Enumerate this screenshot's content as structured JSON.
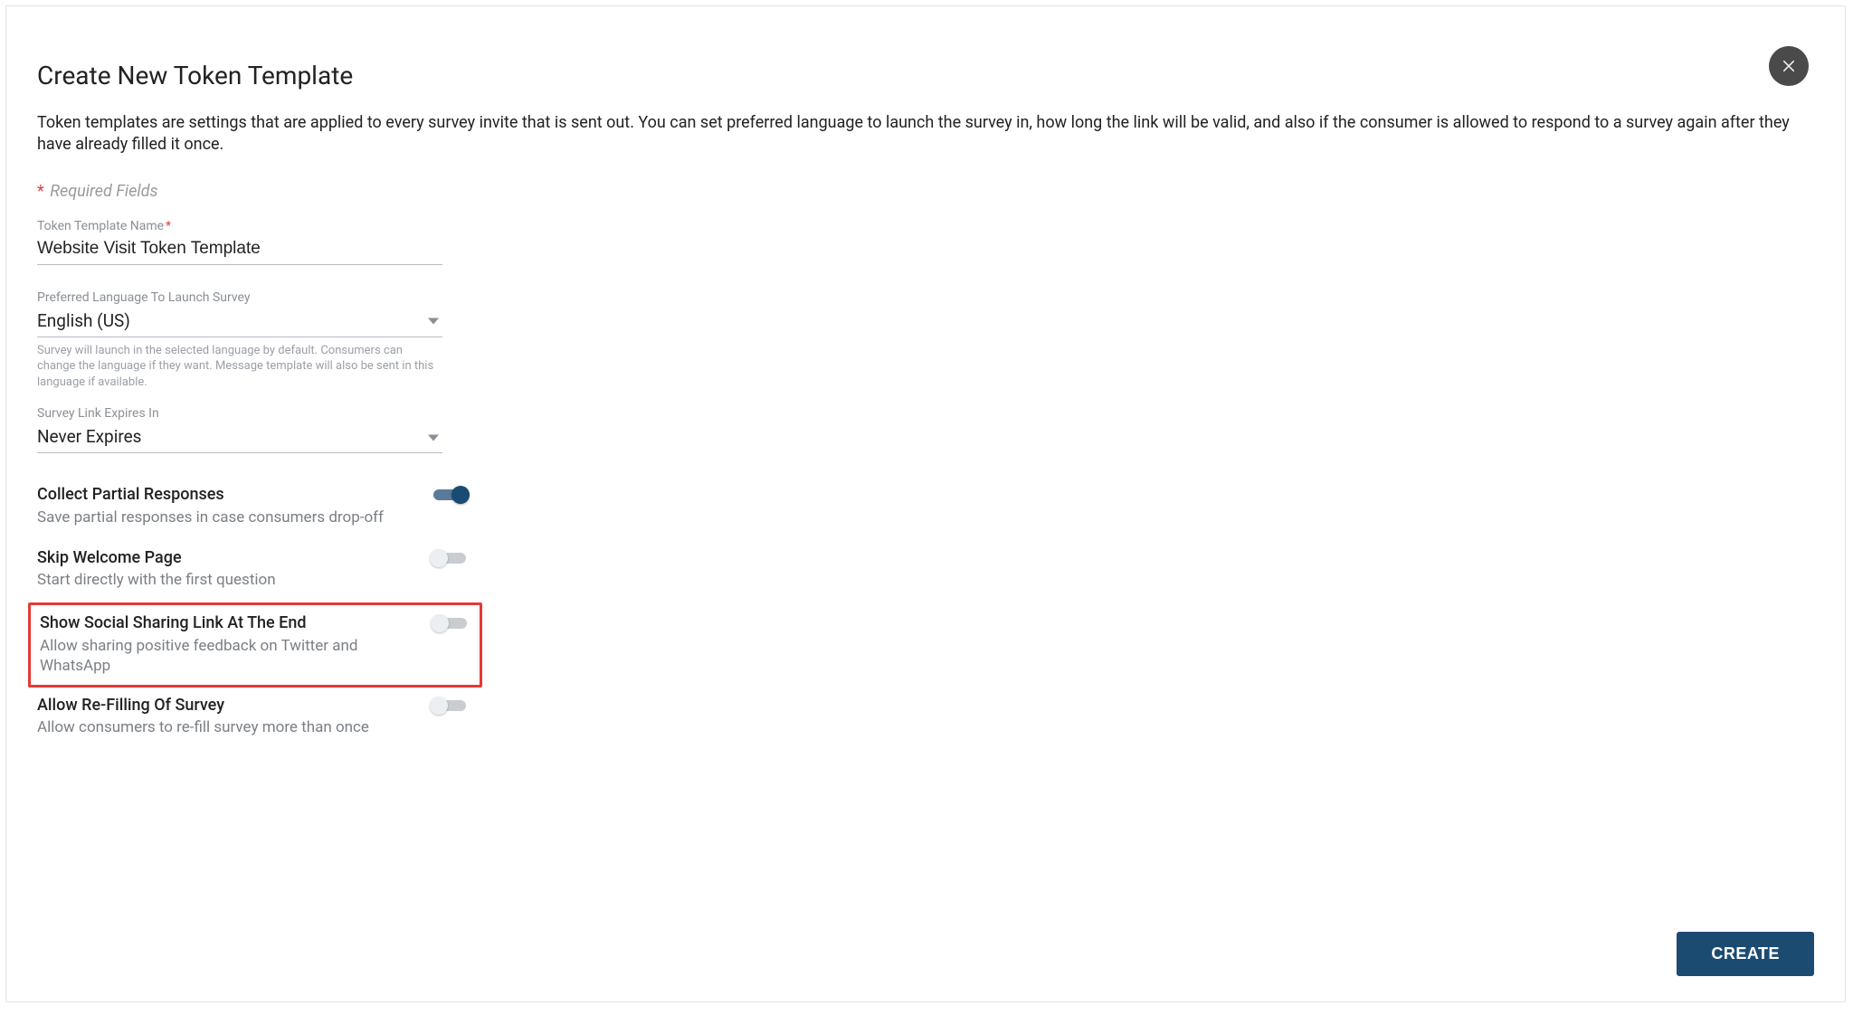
{
  "header": {
    "title": "Create New Token Template",
    "intro": "Token templates are settings that are applied to every survey invite that is sent out. You can set preferred language to launch the survey in, how long the link will be valid, and also if the consumer is allowed to respond to a survey again after they have already filled it once.",
    "required_label": "Required Fields"
  },
  "fields": {
    "name": {
      "label": "Token Template Name",
      "value": "Website Visit Token Template"
    },
    "language": {
      "label": "Preferred Language To Launch Survey",
      "value": "English (US)",
      "helper": "Survey will launch in the selected language by default. Consumers can change the language if they want. Message template will also be sent in this language if available."
    },
    "expires": {
      "label": "Survey Link Expires In",
      "value": "Never Expires"
    }
  },
  "toggles": {
    "partial": {
      "title": "Collect Partial Responses",
      "sub": "Save partial responses in case consumers drop-off",
      "on": true
    },
    "welcome": {
      "title": "Skip Welcome Page",
      "sub": "Start directly with the first question",
      "on": false
    },
    "social": {
      "title": "Show Social Sharing Link At The End",
      "sub": "Allow sharing positive feedback on Twitter and WhatsApp",
      "on": false
    },
    "refill": {
      "title": "Allow Re-Filling Of Survey",
      "sub": "Allow consumers to re-fill survey more than once",
      "on": false
    }
  },
  "buttons": {
    "create": "CREATE"
  }
}
